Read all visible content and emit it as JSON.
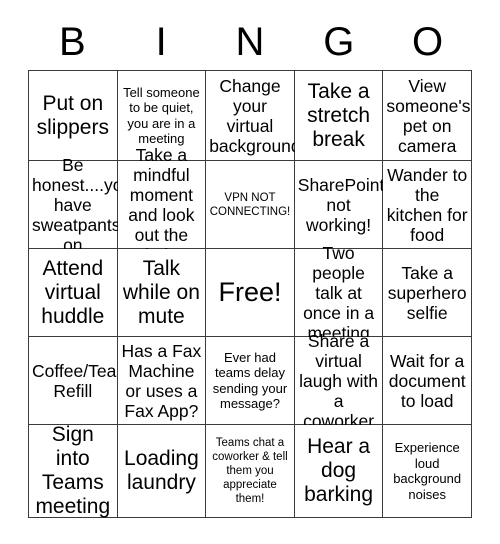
{
  "card": {
    "title": "BINGO",
    "header_letters": [
      "B",
      "I",
      "N",
      "G",
      "O"
    ],
    "free_space_label": "Free!",
    "rows": [
      [
        "Put on slippers",
        "Tell someone to be quiet, you are in a meeting",
        "Change your virtual background",
        "Take a stretch break",
        "View someone's pet on camera"
      ],
      [
        "Be honest....you have sweatpants on",
        "Take a mindful moment and look out the window",
        "VPN NOT CONNECTING!",
        "SharePoint not working!",
        "Wander to the kitchen for food"
      ],
      [
        "Attend virtual huddle",
        "Talk while on mute",
        "Free!",
        "Two people talk at once in a meeting",
        "Take a superhero selfie"
      ],
      [
        "Coffee/Tea Refill",
        "Has a Fax Machine or uses a Fax App?",
        "Ever had teams delay sending your message?",
        "Share a virtual laugh with a coworker",
        "Wait for a document to load"
      ],
      [
        "Sign into Teams meeting",
        "Loading laundry",
        "Teams chat a coworker & tell them you appreciate them!",
        "Hear a dog barking",
        "Experience loud background noises"
      ]
    ]
  },
  "colors": {
    "border": "#3b3b3b",
    "text": "#000000",
    "background": "#ffffff"
  }
}
